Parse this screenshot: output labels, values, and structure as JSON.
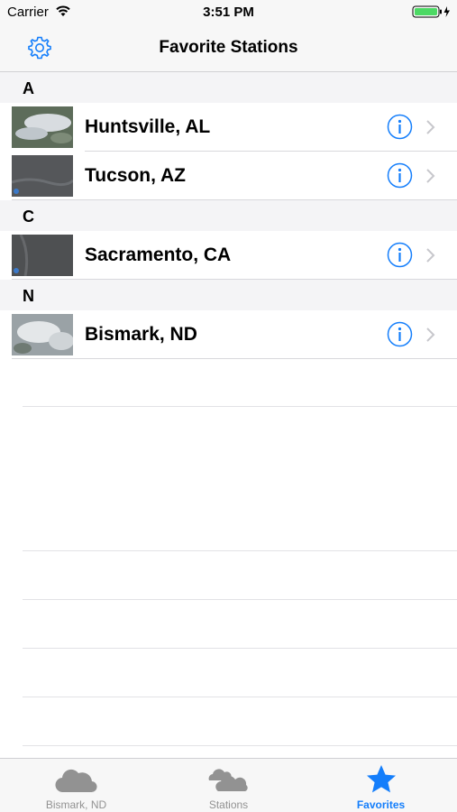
{
  "status_bar": {
    "carrier": "Carrier",
    "time": "3:51 PM"
  },
  "nav": {
    "title": "Favorite Stations",
    "settings_icon": "gear-icon"
  },
  "sections": [
    {
      "header": "A",
      "rows": [
        {
          "label": "Huntsville, AL"
        },
        {
          "label": "Tucson, AZ"
        }
      ]
    },
    {
      "header": "C",
      "rows": [
        {
          "label": "Sacramento, CA"
        }
      ]
    },
    {
      "header": "N",
      "rows": [
        {
          "label": "Bismark, ND"
        }
      ]
    }
  ],
  "tabs": [
    {
      "label": "Bismark, ND",
      "icon": "cloud-icon",
      "active": false
    },
    {
      "label": "Stations",
      "icon": "clouds-icon",
      "active": false
    },
    {
      "label": "Favorites",
      "icon": "star-icon",
      "active": true
    }
  ],
  "colors": {
    "accent": "#147efb",
    "inactive": "#929292",
    "battery": "#4cd964"
  }
}
